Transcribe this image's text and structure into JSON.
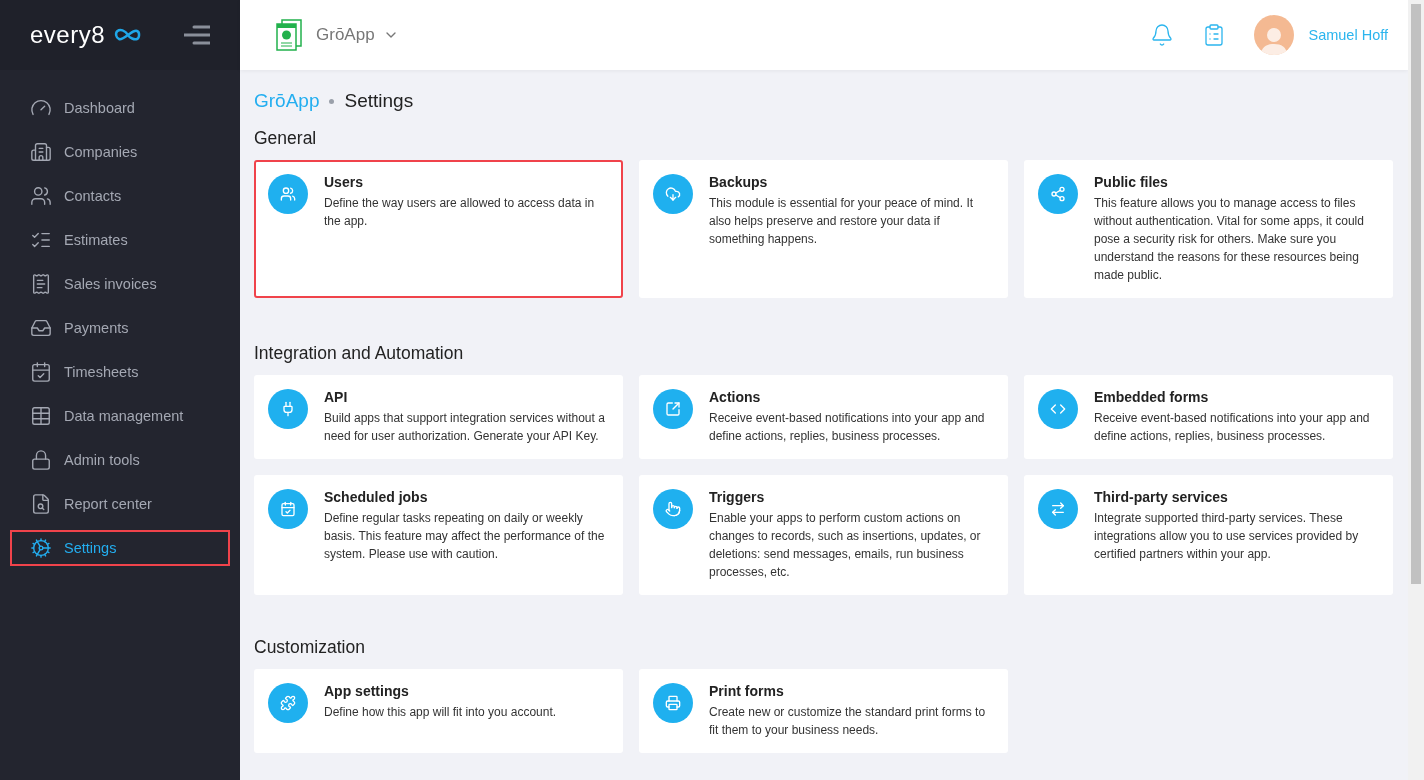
{
  "brand": {
    "logo": "every8"
  },
  "sidebar": {
    "items": [
      {
        "label": "Dashboard",
        "selected": false,
        "highlighted": false
      },
      {
        "label": "Companies",
        "selected": false,
        "highlighted": false
      },
      {
        "label": "Contacts",
        "selected": false,
        "highlighted": false
      },
      {
        "label": "Estimates",
        "selected": false,
        "highlighted": false
      },
      {
        "label": "Sales invoices",
        "selected": false,
        "highlighted": false
      },
      {
        "label": "Payments",
        "selected": false,
        "highlighted": false
      },
      {
        "label": "Timesheets",
        "selected": false,
        "highlighted": false
      },
      {
        "label": "Data management",
        "selected": false,
        "highlighted": false
      },
      {
        "label": "Admin tools",
        "selected": false,
        "highlighted": false
      },
      {
        "label": "Report center",
        "selected": false,
        "highlighted": false
      },
      {
        "label": "Settings",
        "selected": true,
        "highlighted": true
      }
    ]
  },
  "topbar": {
    "app_name": "GrōApp",
    "user_name": "Samuel Hoff"
  },
  "breadcrumb": {
    "app": "GrōApp",
    "page": "Settings"
  },
  "sections": [
    {
      "title": "General",
      "cards": [
        {
          "title": "Users",
          "description": "Define the way users are allowed to access data in the app.",
          "highlighted": true
        },
        {
          "title": "Backups",
          "description": "This module is essential for your peace of mind. It also helps preserve and restore your data if something happens.",
          "highlighted": false
        },
        {
          "title": "Public files",
          "description": "This feature allows you to manage access to files without authentication. Vital for some apps, it could pose a security risk for others. Make sure you understand the reasons for these resources being made public.",
          "highlighted": false
        }
      ]
    },
    {
      "title": "Integration and Automation",
      "cards": [
        {
          "title": "API",
          "description": "Build apps that support integration services without a need for user authorization. Generate your API Key.",
          "highlighted": false
        },
        {
          "title": "Actions",
          "description": "Receive event-based notifications into your app and define actions, replies, business processes.",
          "highlighted": false
        },
        {
          "title": "Embedded forms",
          "description": "Receive event-based notifications into your app and define actions, replies, business processes.",
          "highlighted": false
        },
        {
          "title": "Scheduled jobs",
          "description": "Define regular tasks repeating on daily or weekly basis. This feature may affect the performance of the system. Please use with caution.",
          "highlighted": false
        },
        {
          "title": "Triggers",
          "description": "Enable your apps to perform custom actions on changes to records, such as insertions, updates, or deletions: send messages, emails, run business processes, etc.",
          "highlighted": false
        },
        {
          "title": "Third-party services",
          "description": "Integrate supported third-party services. These integrations allow you to use services provided by certified partners within your app.",
          "highlighted": false
        }
      ]
    },
    {
      "title": "Customization",
      "cards": [
        {
          "title": "App settings",
          "description": "Define how this app will fit into you account.",
          "highlighted": false
        },
        {
          "title": "Print forms",
          "description": "Create new or customize the standard print forms to fit them to your business needs.",
          "highlighted": false
        }
      ]
    }
  ]
}
